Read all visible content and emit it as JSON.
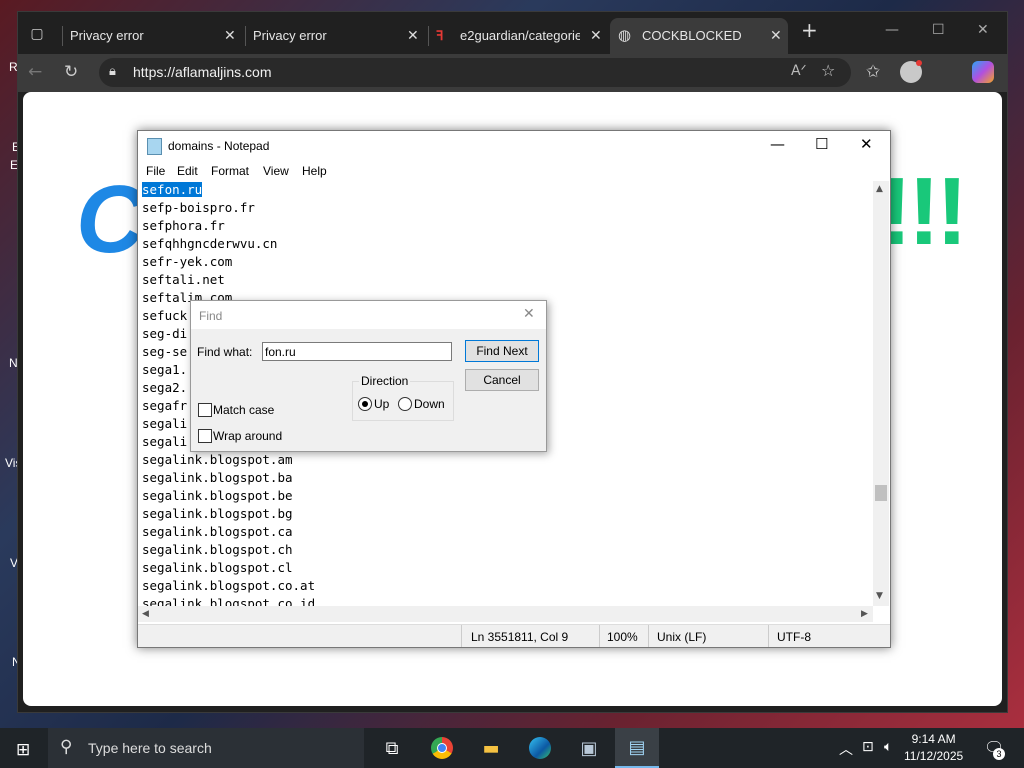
{
  "desktop": {
    "labels": [
      "R",
      "E",
      "E",
      "N",
      "Vis",
      "V",
      "N"
    ]
  },
  "browser": {
    "tabs": [
      {
        "title": "Privacy error"
      },
      {
        "title": "Privacy error"
      },
      {
        "title": "e2guardian/categories"
      },
      {
        "title": "COCKBLOCKED"
      }
    ],
    "url": "https://aflamaljins.com",
    "page": {
      "heading_left": "C",
      "heading_right": "!!!"
    }
  },
  "notepad": {
    "title": "domains - Notepad",
    "menu": [
      "File",
      "Edit",
      "Format",
      "View",
      "Help"
    ],
    "lines": [
      "sefon.ru",
      "sefp-boispro.fr",
      "sefphora.fr",
      "sefqhhgncderwvu.cn",
      "sefr-yek.com",
      "seftali.net",
      "seftalim.com",
      "sefuck",
      "seg-di",
      "seg-se",
      "sega1.",
      "sega2.",
      "segafr",
      "segali",
      "segali",
      "segalink.blogspot.am",
      "segalink.blogspot.ba",
      "segalink.blogspot.be",
      "segalink.blogspot.bg",
      "segalink.blogspot.ca",
      "segalink.blogspot.ch",
      "segalink.blogspot.cl",
      "segalink.blogspot.co.at",
      "segalink.blogspot.co.id"
    ],
    "status": {
      "position": "Ln 3551811, Col 9",
      "zoom": "100%",
      "line_ending": "Unix (LF)",
      "encoding": "UTF-8"
    }
  },
  "find_dialog": {
    "title": "Find",
    "find_what_label": "Find what:",
    "find_what_value": "fon.ru",
    "find_next_label": "Find Next",
    "cancel_label": "Cancel",
    "direction_label": "Direction",
    "up_label": "Up",
    "down_label": "Down",
    "direction_selected": "Up",
    "match_case_label": "Match case",
    "wrap_around_label": "Wrap around"
  },
  "taskbar": {
    "search_placeholder": "Type here to search",
    "time": "9:14 AM",
    "date": "11/12/2025",
    "notification_count": "3"
  }
}
